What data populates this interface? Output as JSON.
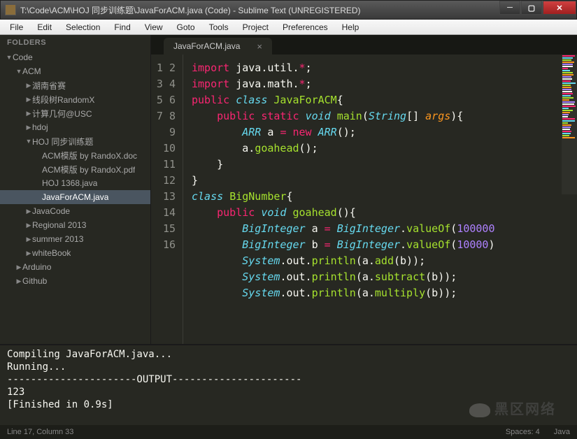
{
  "window": {
    "title": "T:\\Code\\ACM\\HOJ 同步训练题\\JavaForACM.java (Code) - Sublime Text (UNREGISTERED)"
  },
  "menu": [
    "File",
    "Edit",
    "Selection",
    "Find",
    "View",
    "Goto",
    "Tools",
    "Project",
    "Preferences",
    "Help"
  ],
  "sidebar": {
    "header": "FOLDERS",
    "tree": [
      {
        "label": "Code",
        "depth": 0,
        "type": "folder-open"
      },
      {
        "label": "ACM",
        "depth": 1,
        "type": "folder-open"
      },
      {
        "label": "湖南省赛",
        "depth": 2,
        "type": "folder"
      },
      {
        "label": "线段树RandomX",
        "depth": 2,
        "type": "folder"
      },
      {
        "label": "计算几何@USC",
        "depth": 2,
        "type": "folder"
      },
      {
        "label": "hdoj",
        "depth": 2,
        "type": "folder"
      },
      {
        "label": "HOJ 同步训练题",
        "depth": 2,
        "type": "folder-open"
      },
      {
        "label": "ACM模版 by RandoX.doc",
        "depth": 3,
        "type": "file"
      },
      {
        "label": "ACM模版 by RandoX.pdf",
        "depth": 3,
        "type": "file"
      },
      {
        "label": "HOJ 1368.java",
        "depth": 3,
        "type": "file"
      },
      {
        "label": "JavaForACM.java",
        "depth": 3,
        "type": "file",
        "selected": true
      },
      {
        "label": "JavaCode",
        "depth": 2,
        "type": "folder"
      },
      {
        "label": "Regional 2013",
        "depth": 2,
        "type": "folder"
      },
      {
        "label": "summer 2013",
        "depth": 2,
        "type": "folder"
      },
      {
        "label": "whiteBook",
        "depth": 2,
        "type": "folder"
      },
      {
        "label": "Arduino",
        "depth": 1,
        "type": "folder"
      },
      {
        "label": "Github",
        "depth": 1,
        "type": "folder"
      }
    ]
  },
  "tab": {
    "name": "JavaForACM.java"
  },
  "code": {
    "lines": [
      [
        {
          "t": "import",
          "c": "kw-red"
        },
        {
          "t": " java.util.",
          "c": "kw-white"
        },
        {
          "t": "*",
          "c": "kw-red"
        },
        {
          "t": ";",
          "c": "kw-white"
        }
      ],
      [
        {
          "t": "import",
          "c": "kw-red"
        },
        {
          "t": " java.math.",
          "c": "kw-white"
        },
        {
          "t": "*",
          "c": "kw-red"
        },
        {
          "t": ";",
          "c": "kw-white"
        }
      ],
      [
        {
          "t": "public",
          "c": "kw-red"
        },
        {
          "t": " ",
          "c": ""
        },
        {
          "t": "class",
          "c": "kw-blue"
        },
        {
          "t": " ",
          "c": ""
        },
        {
          "t": "JavaForACM",
          "c": "kw-green"
        },
        {
          "t": "{",
          "c": "kw-white"
        }
      ],
      [
        {
          "t": "    ",
          "c": ""
        },
        {
          "t": "public",
          "c": "kw-red"
        },
        {
          "t": " ",
          "c": ""
        },
        {
          "t": "static",
          "c": "kw-red"
        },
        {
          "t": " ",
          "c": ""
        },
        {
          "t": "void",
          "c": "kw-blue"
        },
        {
          "t": " ",
          "c": ""
        },
        {
          "t": "main",
          "c": "kw-green"
        },
        {
          "t": "(",
          "c": "kw-white"
        },
        {
          "t": "String",
          "c": "kw-blue"
        },
        {
          "t": "[] ",
          "c": "kw-white"
        },
        {
          "t": "args",
          "c": "kw-orange"
        },
        {
          "t": "){",
          "c": "kw-white"
        }
      ],
      [
        {
          "t": "        ",
          "c": ""
        },
        {
          "t": "ARR",
          "c": "kw-blue"
        },
        {
          "t": " a ",
          "c": "kw-white"
        },
        {
          "t": "=",
          "c": "kw-red"
        },
        {
          "t": " ",
          "c": ""
        },
        {
          "t": "new",
          "c": "kw-red"
        },
        {
          "t": " ",
          "c": ""
        },
        {
          "t": "ARR",
          "c": "kw-blue"
        },
        {
          "t": "();",
          "c": "kw-white"
        }
      ],
      [
        {
          "t": "        a.",
          "c": "kw-white"
        },
        {
          "t": "goahead",
          "c": "kw-green"
        },
        {
          "t": "();",
          "c": "kw-white"
        }
      ],
      [
        {
          "t": "    }",
          "c": "kw-white"
        }
      ],
      [
        {
          "t": "}",
          "c": "kw-white"
        }
      ],
      [
        {
          "t": "",
          "c": ""
        }
      ],
      [
        {
          "t": "class",
          "c": "kw-blue"
        },
        {
          "t": " ",
          "c": ""
        },
        {
          "t": "BigNumber",
          "c": "kw-green"
        },
        {
          "t": "{",
          "c": "kw-white"
        }
      ],
      [
        {
          "t": "    ",
          "c": ""
        },
        {
          "t": "public",
          "c": "kw-red"
        },
        {
          "t": " ",
          "c": ""
        },
        {
          "t": "void",
          "c": "kw-blue"
        },
        {
          "t": " ",
          "c": ""
        },
        {
          "t": "goahead",
          "c": "kw-green"
        },
        {
          "t": "(){",
          "c": "kw-white"
        }
      ],
      [
        {
          "t": "        ",
          "c": ""
        },
        {
          "t": "BigInteger",
          "c": "kw-blue"
        },
        {
          "t": " a ",
          "c": "kw-white"
        },
        {
          "t": "=",
          "c": "kw-red"
        },
        {
          "t": " ",
          "c": ""
        },
        {
          "t": "BigInteger",
          "c": "kw-blue"
        },
        {
          "t": ".",
          "c": "kw-white"
        },
        {
          "t": "valueOf",
          "c": "kw-green"
        },
        {
          "t": "(",
          "c": "kw-white"
        },
        {
          "t": "100000",
          "c": "kw-purple"
        }
      ],
      [
        {
          "t": "        ",
          "c": ""
        },
        {
          "t": "BigInteger",
          "c": "kw-blue"
        },
        {
          "t": " b ",
          "c": "kw-white"
        },
        {
          "t": "=",
          "c": "kw-red"
        },
        {
          "t": " ",
          "c": ""
        },
        {
          "t": "BigInteger",
          "c": "kw-blue"
        },
        {
          "t": ".",
          "c": "kw-white"
        },
        {
          "t": "valueOf",
          "c": "kw-green"
        },
        {
          "t": "(",
          "c": "kw-white"
        },
        {
          "t": "10000",
          "c": "kw-purple"
        },
        {
          "t": ")",
          "c": "kw-white"
        }
      ],
      [
        {
          "t": "        ",
          "c": ""
        },
        {
          "t": "System",
          "c": "kw-blue"
        },
        {
          "t": ".out.",
          "c": "kw-white"
        },
        {
          "t": "println",
          "c": "kw-green"
        },
        {
          "t": "(a.",
          "c": "kw-white"
        },
        {
          "t": "add",
          "c": "kw-green"
        },
        {
          "t": "(b));",
          "c": "kw-white"
        }
      ],
      [
        {
          "t": "        ",
          "c": ""
        },
        {
          "t": "System",
          "c": "kw-blue"
        },
        {
          "t": ".out.",
          "c": "kw-white"
        },
        {
          "t": "println",
          "c": "kw-green"
        },
        {
          "t": "(a.",
          "c": "kw-white"
        },
        {
          "t": "subtract",
          "c": "kw-green"
        },
        {
          "t": "(b));",
          "c": "kw-white"
        }
      ],
      [
        {
          "t": "        ",
          "c": ""
        },
        {
          "t": "System",
          "c": "kw-blue"
        },
        {
          "t": ".out.",
          "c": "kw-white"
        },
        {
          "t": "println",
          "c": "kw-green"
        },
        {
          "t": "(a.",
          "c": "kw-white"
        },
        {
          "t": "multiply",
          "c": "kw-green"
        },
        {
          "t": "(b));",
          "c": "kw-white"
        }
      ]
    ]
  },
  "console": {
    "lines": [
      "Compiling JavaForACM.java...",
      "Running...",
      "----------------------OUTPUT----------------------",
      "123",
      "[Finished in 0.9s]"
    ]
  },
  "status": {
    "left": "Line 17, Column 33",
    "spaces": "Spaces: 4",
    "lang": "Java"
  },
  "watermark": "黑区网络"
}
